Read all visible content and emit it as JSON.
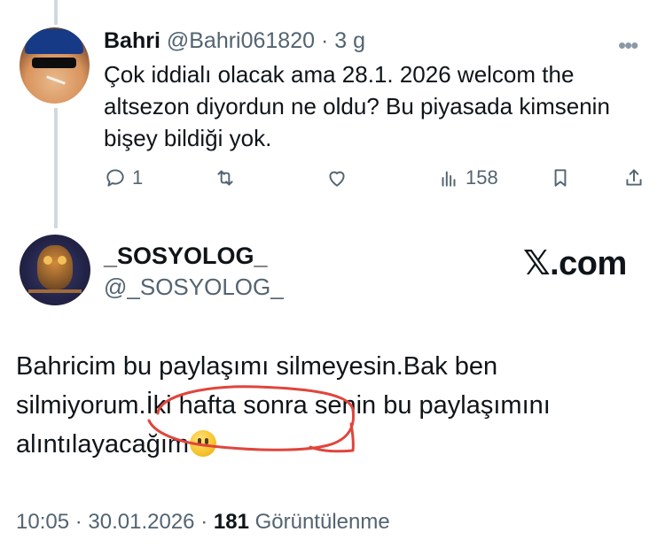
{
  "parent_tweet": {
    "name": "Bahri",
    "handle": "@Bahri061820",
    "separator": "·",
    "time": "3 g",
    "text": "Çok iddialı olacak ama 28.1. 2026 welcom the altsezon diyordun ne oldu? Bu piyasada kimsenin bişey bildiği yok.",
    "actions": {
      "reply_count": "1",
      "retweet_count": "",
      "like_count": "",
      "views_count": "158"
    }
  },
  "main_tweet": {
    "name": "_SOSYOLOG_",
    "handle": "@_SOSYOLOG_",
    "watermark": "𝕏.com",
    "text_before": "Bahricim bu paylaşımı silmeyesin.Bak ben silmiyorum.İki hafta sonra senin bu paylaşımını alıntılayacağım",
    "emoji": "upside-down-face",
    "time": "10:05",
    "date": "30.01.2026",
    "separator": "·",
    "views_count": "181",
    "views_label": "Görüntülenme"
  },
  "colors": {
    "secondary_text": "#536471",
    "thread_line": "#cfd9de",
    "annotation_red": "#e0453c"
  }
}
